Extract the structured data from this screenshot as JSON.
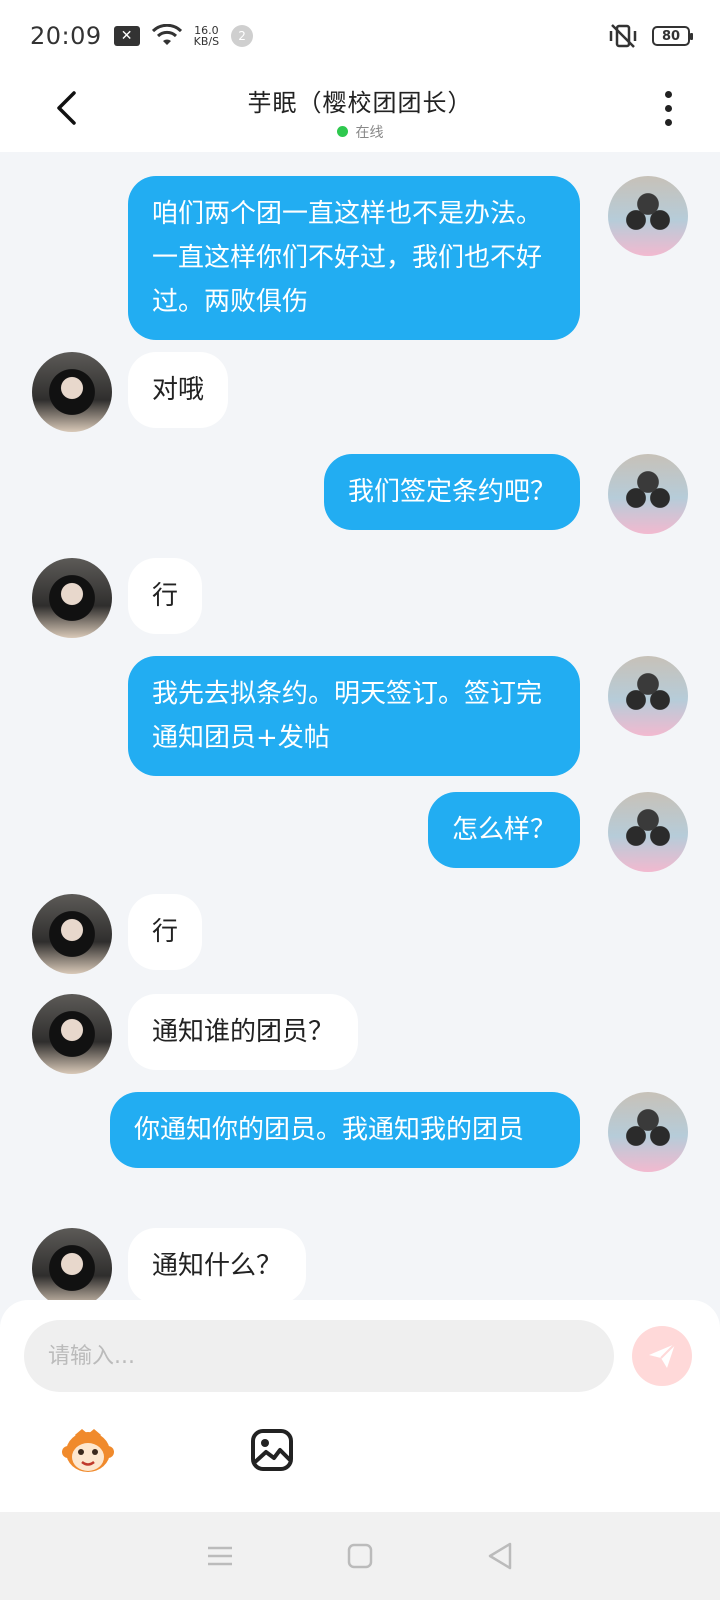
{
  "status_bar": {
    "time": "20:09",
    "speed_value": "16.0",
    "speed_unit": "KB/S",
    "notification_count": "2",
    "battery": "80"
  },
  "header": {
    "title": "芋眠（樱校团团长）",
    "status": "在线"
  },
  "messages": [
    {
      "side": "me",
      "text": "咱们两个团一直这样也不是办法。一直这样你们不好过，我们也不好过。两败俱伤"
    },
    {
      "side": "them",
      "text": "对哦"
    },
    {
      "side": "me",
      "text": "我们签定条约吧？"
    },
    {
      "side": "them",
      "text": "行"
    },
    {
      "side": "me",
      "text": "我先去拟条约。明天签订。签订完通知团员+发帖"
    },
    {
      "side": "me",
      "text": "怎么样？"
    },
    {
      "side": "them",
      "text": "行"
    },
    {
      "side": "them",
      "text": "通知谁的团员？"
    },
    {
      "side": "me",
      "text": "你通知你的团员。我通知我的团员"
    },
    {
      "side": "them",
      "text": "通知什么？"
    }
  ],
  "input": {
    "placeholder": "请输入..."
  },
  "icons": {
    "back": "back-arrow-icon",
    "more": "more-vertical-icon",
    "send": "send-icon",
    "emoji": "monkey-emoji-icon",
    "image": "image-icon",
    "nav_menu": "menu-icon",
    "nav_home": "home-square-icon",
    "nav_back": "back-triangle-icon"
  },
  "colors": {
    "bubble_me": "#22adf2",
    "bubble_them": "#ffffff",
    "online": "#2ec84e",
    "send_disabled": "#ffd9d9"
  }
}
